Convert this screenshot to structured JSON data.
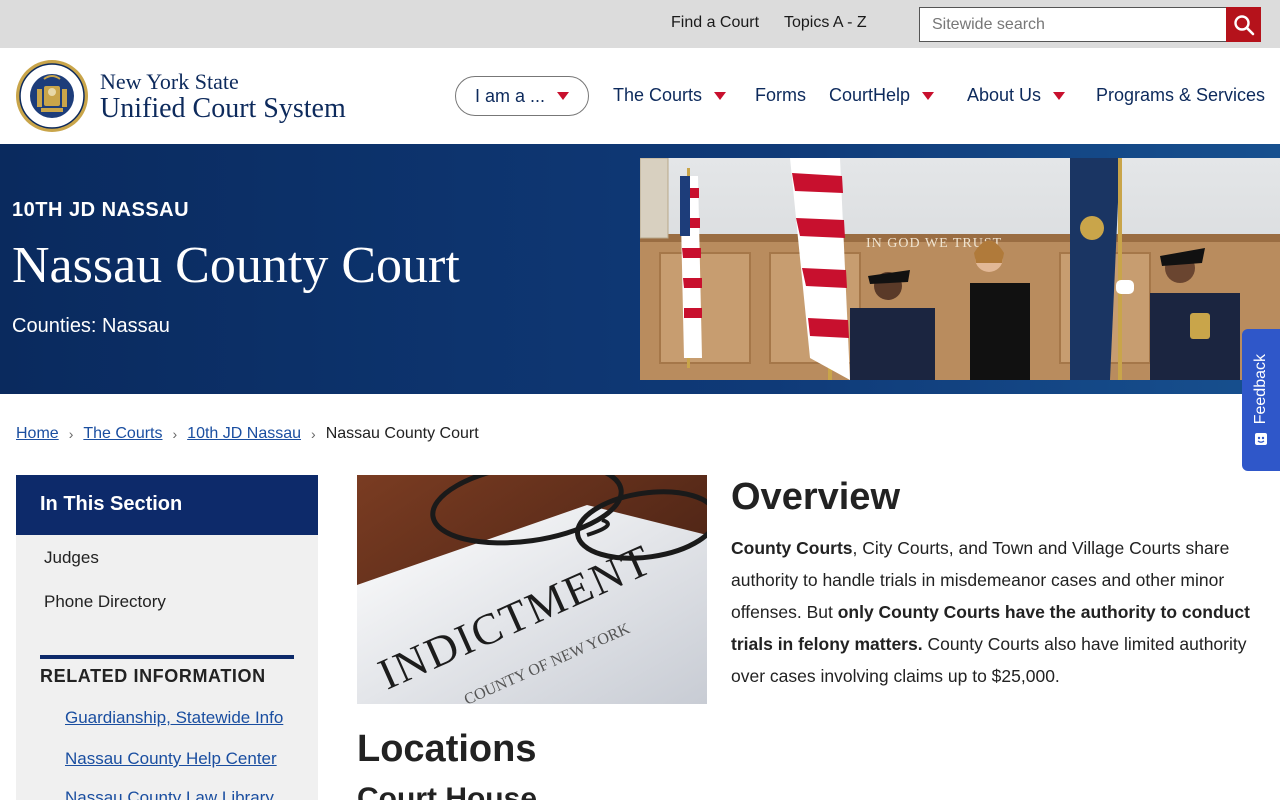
{
  "utility": {
    "links": [
      "Find a Court",
      "Topics A - Z"
    ],
    "search_placeholder": "Sitewide search"
  },
  "brand": {
    "line1": "New York State",
    "line2": "Unified Court System",
    "seal_text": "NEW YORK STATE UNIFIED COURT SYSTEM"
  },
  "nav": {
    "i_am_a": "I am a ...",
    "items": [
      "The Courts",
      "Forms",
      "CourtHelp",
      "About Us",
      "Programs & Services"
    ]
  },
  "hero": {
    "eyebrow": "10TH JD NASSAU",
    "title": "Nassau County Court",
    "subtitle": "Counties: Nassau",
    "photo_text": "IN GOD WE TRUST"
  },
  "feedback": {
    "label": "Feedback"
  },
  "breadcrumb": {
    "links": [
      "Home",
      "The Courts",
      "10th JD Nassau"
    ],
    "current": "Nassau County Court"
  },
  "sidebar": {
    "heading": "In This Section",
    "links": [
      "Judges",
      "Phone Directory"
    ],
    "related_heading": "RELATED INFORMATION",
    "related_links": [
      "Guardianship, Statewide Info",
      "Nassau County Help Center",
      "Nassau County Law Library"
    ]
  },
  "content": {
    "image_text": "INDICTMENT",
    "image_subtext": "COUNTY OF NEW YORK",
    "overview_title": "Overview",
    "overview_p1_bold": "County Courts",
    "overview_p1_a": ", City Courts, and Town and Village Courts share authority to handle trials in misdemeanor cases and other minor offenses. But ",
    "overview_p1_bold2": "only County Courts have the authority to conduct trials in felony matters.",
    "overview_p1_b": " County Courts also have limited authority over cases involving claims up to $25,000.",
    "locations_title": "Locations",
    "courthouse_title": "Court House"
  },
  "colors": {
    "navy": "#0d2a5c",
    "accent_red": "#c8102e",
    "link_blue": "#1a4ea0",
    "feedback_blue": "#2f57c9"
  }
}
